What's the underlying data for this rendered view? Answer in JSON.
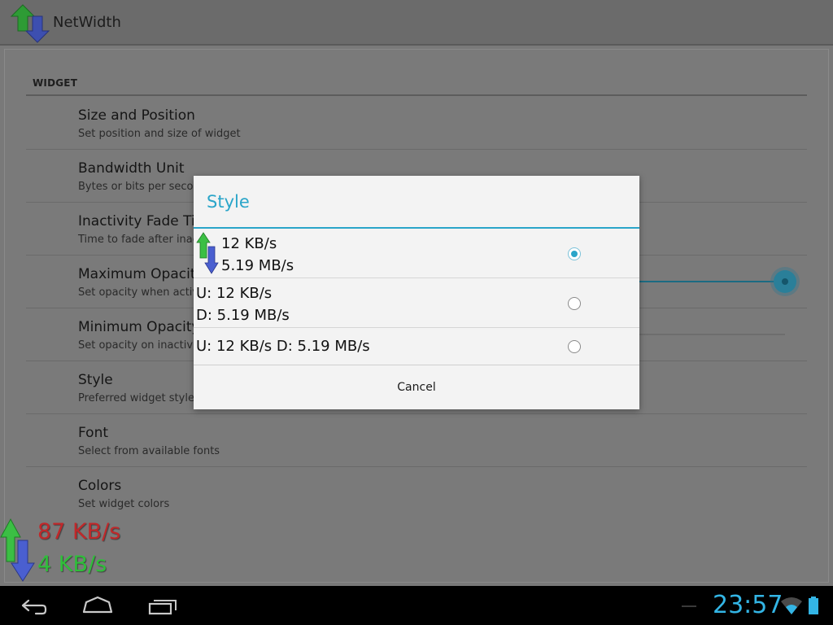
{
  "app": {
    "title": "NetWidth",
    "icon": "up-down-arrows-icon"
  },
  "settings": {
    "section_header": "WIDGET",
    "items": [
      {
        "title": "Size and Position",
        "summary": "Set position and size of widget"
      },
      {
        "title": "Bandwidth Unit",
        "summary": "Bytes or bits per second"
      },
      {
        "title": "Inactivity Fade Time",
        "summary": "Time to fade after inactivity"
      },
      {
        "title": "Maximum Opacity",
        "summary": "Set opacity when active"
      },
      {
        "title": "Minimum Opacity",
        "summary": "Set opacity on inactivity"
      },
      {
        "title": "Style",
        "summary": "Preferred widget style"
      },
      {
        "title": "Font",
        "summary": "Select from available fonts"
      },
      {
        "title": "Colors",
        "summary": "Set widget colors"
      }
    ]
  },
  "widget": {
    "upload": "87 KB/s",
    "download": "4 KB/s",
    "upload_color": "#c0282a",
    "download_color": "#2fbf3a"
  },
  "dialog": {
    "title": "Style",
    "options": [
      {
        "line1": "12 KB/s",
        "line2": "5.19 MB/s",
        "selected": true,
        "icon": "up-down-arrows-icon"
      },
      {
        "line1": "U: 12 KB/s",
        "line2": "D: 5.19 MB/s",
        "selected": false
      },
      {
        "line1": "U: 12 KB/s D: 5.19 MB/s",
        "selected": false
      }
    ],
    "cancel_label": "Cancel"
  },
  "system_bar": {
    "time": "23:57",
    "accent": "#33b5e5",
    "icons": [
      "back-icon",
      "home-icon",
      "recent-apps-icon",
      "wifi-icon",
      "battery-icon"
    ]
  }
}
